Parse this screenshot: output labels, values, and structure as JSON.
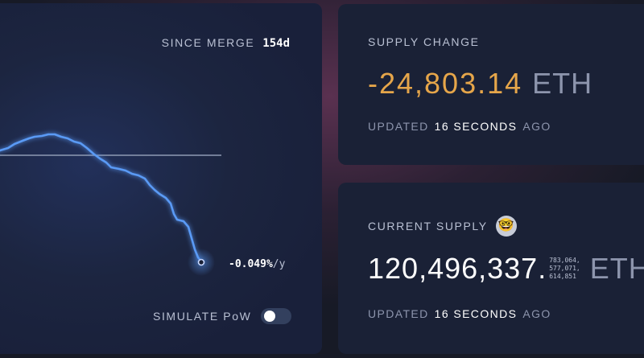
{
  "chart_card": {
    "since_merge_label": "SINCE MERGE",
    "since_merge_value": "154d",
    "rate_value": "-0.049%",
    "rate_unit": "/y",
    "simulate_label": "SIMULATE PoW",
    "simulate_pow_enabled": false,
    "colors": {
      "line": "#5a9af5",
      "baseline": "#8e9ab3"
    }
  },
  "supply_change": {
    "title": "SUPPLY CHANGE",
    "value": "-24,803.14",
    "unit": "ETH",
    "updated_prefix": "UPDATED",
    "updated_value": "16 SECONDS",
    "updated_suffix": "AGO",
    "color": "#e6a64a"
  },
  "current_supply": {
    "title": "CURRENT SUPPLY",
    "icon": "nerd-face-icon",
    "value": "120,496,337",
    "dot": ".",
    "decimals": [
      "783,064,",
      "577,071,",
      "614,851"
    ],
    "unit": "ETH",
    "updated_prefix": "UPDATED",
    "updated_value": "16 SECONDS",
    "updated_suffix": "AGO"
  }
}
